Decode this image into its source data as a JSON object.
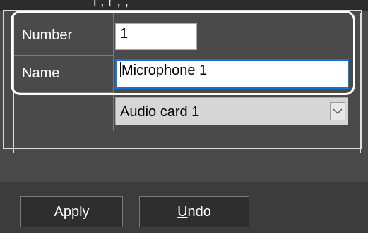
{
  "header": {
    "partial_text": "l , r , ,"
  },
  "form": {
    "number": {
      "label": "Number",
      "value": "1"
    },
    "name": {
      "label": "Name",
      "value": "Microphone 1"
    },
    "device": {
      "selected": "Audio card 1"
    }
  },
  "actions": {
    "apply_label": "Apply",
    "undo_mnemonic": "U",
    "undo_rest": "ndo"
  },
  "icons": {
    "dropdown": "chevron-down-icon"
  }
}
